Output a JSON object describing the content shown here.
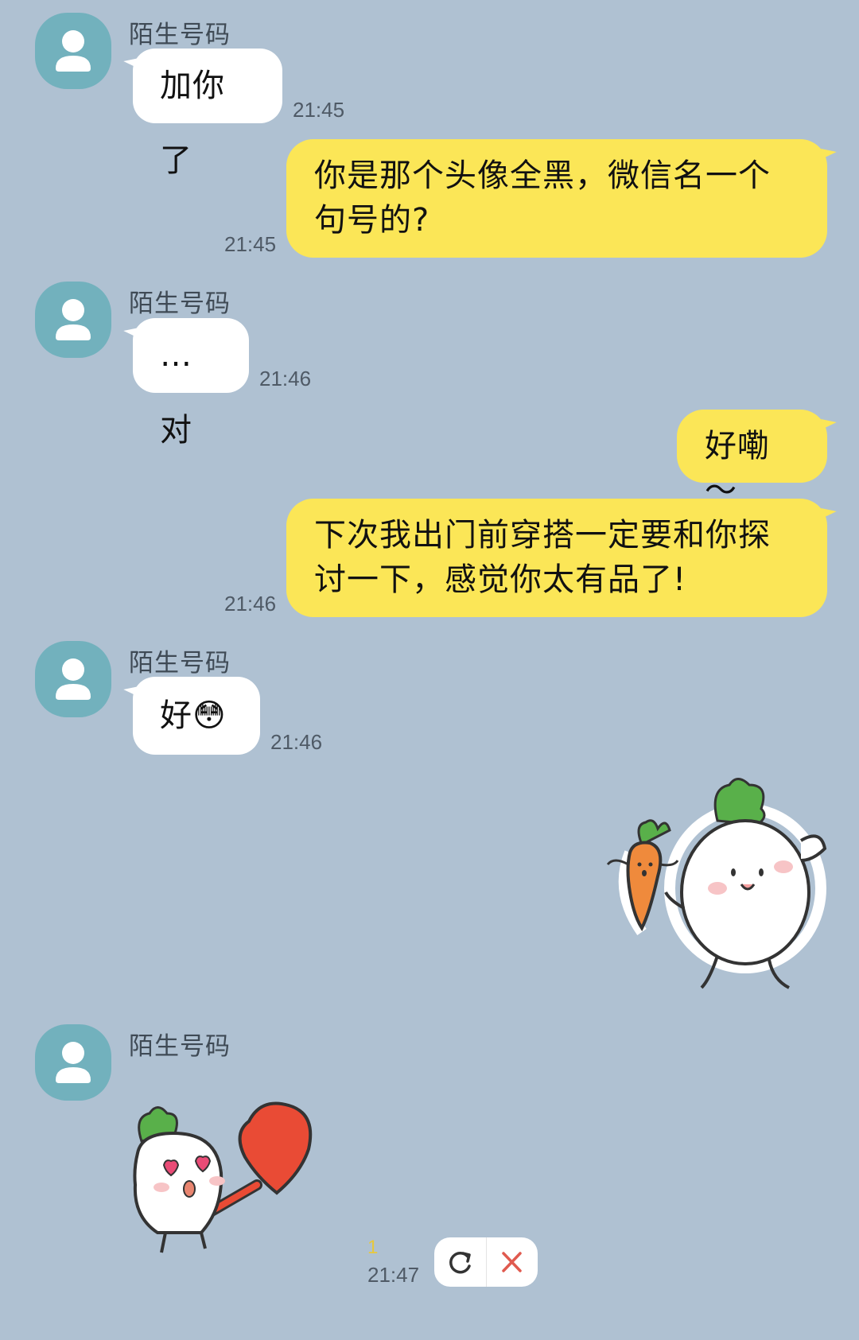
{
  "chat": {
    "sender_name": "陌生号码",
    "messages": [
      {
        "text": "加你了",
        "time": "21:45"
      },
      {
        "text": "你是那个头像全黑，微信名一个句号的?",
        "line1": "你是那个头像全黑，微信名一个",
        "line2": "句号的?",
        "time": "21:45"
      },
      {
        "text": "…对",
        "time": "21:46"
      },
      {
        "text": "好嘞～"
      },
      {
        "text": "下次我出门前穿搭一定要和你探讨一下，感觉你太有品了!",
        "line1": "下次我出门前穿搭一定要和你探",
        "line2": "讨一下，感觉你太有品了!",
        "time": "21:46"
      },
      {
        "text": "好",
        "emoji": "😳",
        "time": "21:46"
      },
      {
        "unread_count": "1",
        "time": "21:47"
      }
    ]
  },
  "icons": {
    "avatar": "user-placeholder-icon",
    "retry": "refresh-icon",
    "delete": "close-icon"
  },
  "colors": {
    "background": "#afc1d2",
    "incoming_bubble": "#ffffff",
    "outgoing_bubble": "#fbe657",
    "avatar": "#72b1bd",
    "unread": "#e7c83d",
    "delete_x": "#e05a4f"
  }
}
